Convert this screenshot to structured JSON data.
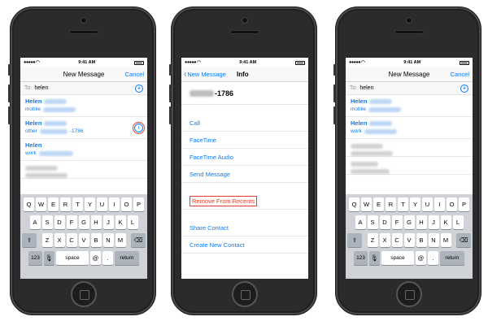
{
  "status": {
    "time": "9:41 AM"
  },
  "phone1": {
    "title": "New Message",
    "cancel": "Cancel",
    "to_label": "To:",
    "to_value": "helen",
    "contacts": [
      {
        "name": "Helen",
        "type": "mobile",
        "suffix": ""
      },
      {
        "name": "Helen",
        "type": "other",
        "suffix": "-1786"
      },
      {
        "name": "Helen",
        "type": "work",
        "suffix": ""
      }
    ]
  },
  "phone2": {
    "back": "New Message",
    "title": "Info",
    "number_suffix": "-1786",
    "actions": [
      "Call",
      "FaceTime",
      "FaceTime Audio",
      "Send Message"
    ],
    "remove": "Remove From Recents",
    "share": "Share Contact",
    "create": "Create New Contact"
  },
  "phone3": {
    "title": "New Message",
    "cancel": "Cancel",
    "to_label": "To:",
    "to_value": "helen",
    "contacts": [
      {
        "name": "Helen",
        "type": "mobile"
      },
      {
        "name": "Helen",
        "type": "work"
      }
    ]
  },
  "keyboard": {
    "row1": [
      "Q",
      "W",
      "E",
      "R",
      "T",
      "Y",
      "U",
      "I",
      "O",
      "P"
    ],
    "row2": [
      "A",
      "S",
      "D",
      "F",
      "G",
      "H",
      "J",
      "K",
      "L"
    ],
    "row3": [
      "Z",
      "X",
      "C",
      "V",
      "B",
      "N",
      "M"
    ],
    "numbers": "123",
    "space": "space",
    "at": "@",
    "dot": ".",
    "return": "return"
  },
  "colors": {
    "accent": "#0a7aff",
    "highlight": "#e53b2c"
  }
}
